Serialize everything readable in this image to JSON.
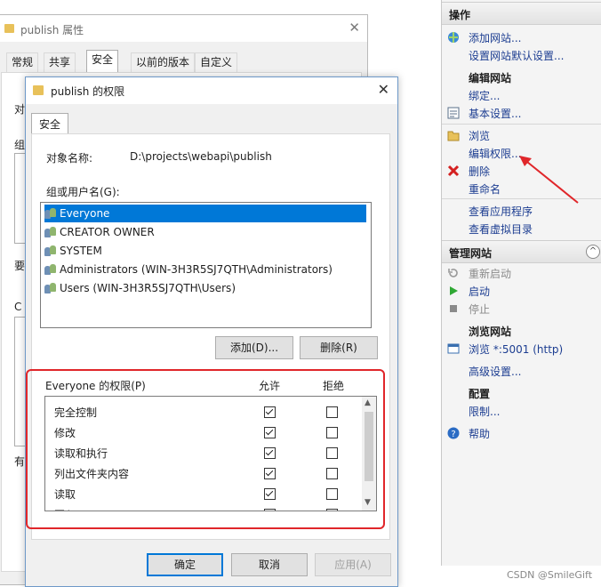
{
  "background_window": {
    "title": "publish 属性",
    "tabs": [
      "常规",
      "共享",
      "安全",
      "以前的版本",
      "自定义"
    ],
    "active_tab": "安全",
    "fragments": [
      "对",
      "组",
      "要",
      "C",
      "有"
    ]
  },
  "dialog": {
    "title": "publish 的权限",
    "tab": "安全",
    "object_name_label": "对象名称:",
    "object_name_value": "D:\\projects\\webapi\\publish",
    "group_label": "组或用户名(G):",
    "groups": [
      {
        "name": "Everyone",
        "selected": true
      },
      {
        "name": "CREATOR OWNER",
        "selected": false
      },
      {
        "name": "SYSTEM",
        "selected": false
      },
      {
        "name": "Administrators (WIN-3H3R5SJ7QTH\\Administrators)",
        "selected": false
      },
      {
        "name": "Users (WIN-3H3R5SJ7QTH\\Users)",
        "selected": false
      }
    ],
    "add_button": "添加(D)...",
    "remove_button": "删除(R)",
    "perm_header": "Everyone 的权限(P)",
    "allow_header": "允许",
    "deny_header": "拒绝",
    "permissions": [
      {
        "name": "完全控制",
        "allow": true,
        "deny": false
      },
      {
        "name": "修改",
        "allow": true,
        "deny": false
      },
      {
        "name": "读取和执行",
        "allow": true,
        "deny": false
      },
      {
        "name": "列出文件夹内容",
        "allow": true,
        "deny": false
      },
      {
        "name": "读取",
        "allow": true,
        "deny": false
      },
      {
        "name": "写入",
        "allow": true,
        "deny": false
      }
    ],
    "ok_button": "确定",
    "cancel_button": "取消",
    "apply_button": "应用(A)"
  },
  "actions_panel": {
    "header": "操作",
    "items_top": [
      "添加网站...",
      "设置网站默认设置..."
    ],
    "edit_site_group": "编辑网站",
    "bind": "绑定...",
    "basic_settings": "基本设置...",
    "browse": "浏览",
    "edit_permissions": "编辑权限...",
    "delete": "删除",
    "rename": "重命名",
    "view_apps": "查看应用程序",
    "view_vdirs": "查看虚拟目录",
    "manage_site_header": "管理网站",
    "restart": "重新启动",
    "start": "启动",
    "stop": "停止",
    "browse_site_group": "浏览网站",
    "browse_port": "浏览 *:5001 (http)",
    "advanced_settings": "高级设置...",
    "config_group": "配置",
    "limits": "限制...",
    "help": "帮助",
    "collapse_glyph": "^"
  },
  "watermark": "CSDN @SmileGift",
  "colors": {
    "selection": "#0078d7",
    "link": "#1c3d91",
    "highlight_box": "#e0262a",
    "arrow": "#e0262a"
  }
}
